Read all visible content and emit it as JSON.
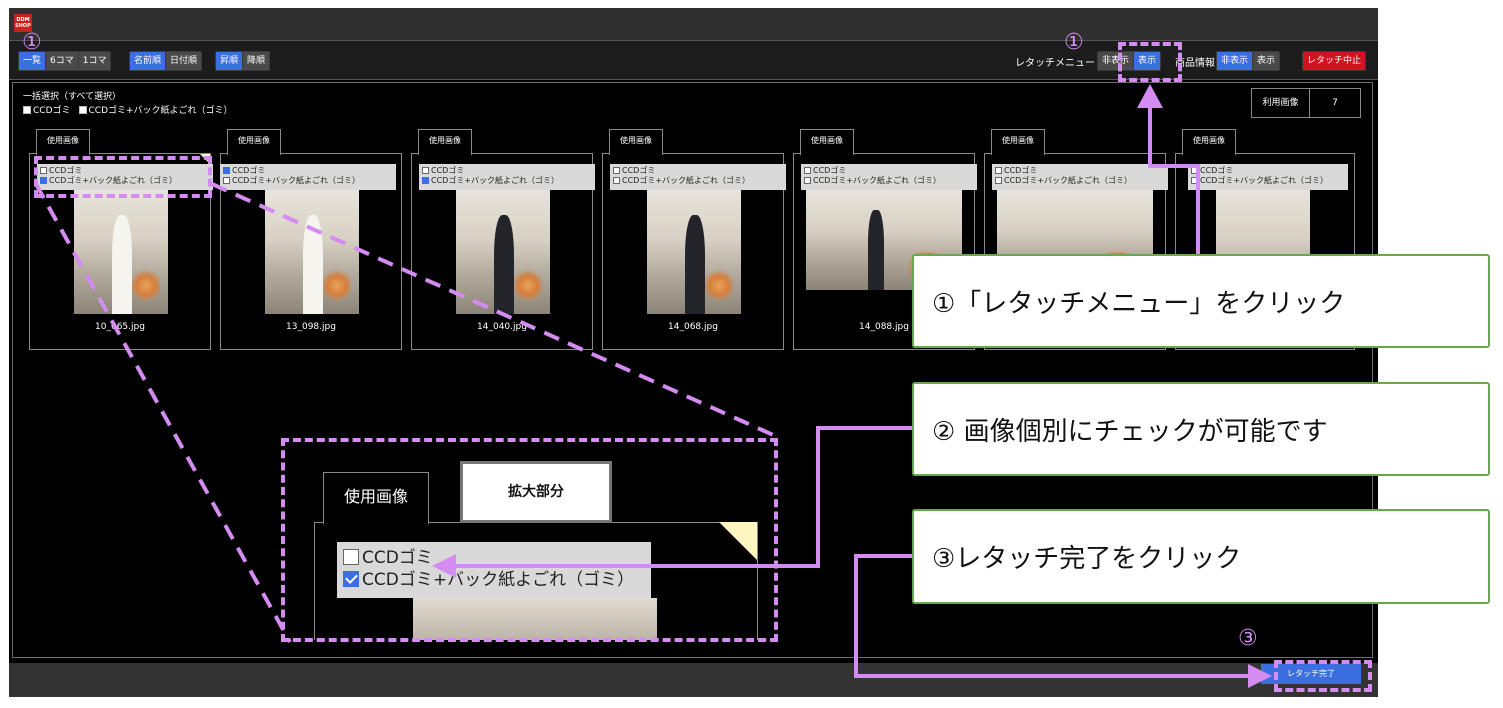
{
  "app": {
    "logo_text": "DDM SHOP"
  },
  "toolbar": {
    "view_group": [
      "一覧",
      "6コマ",
      "1コマ"
    ],
    "sort_group": [
      "名前順",
      "日付順"
    ],
    "order_group": [
      "昇順",
      "降順"
    ],
    "retouch_menu_label": "レタッチメニュー",
    "retouch_menu_options": [
      "非表示",
      "表示"
    ],
    "product_info_label": "商品情報",
    "product_info_options": [
      "非表示",
      "表示"
    ],
    "cancel_button": "レタッチ中止"
  },
  "bulk": {
    "label": "一括選択（すべて選択）",
    "option1": "CCDゴミ",
    "option2": "CCDゴミ+バック紙よごれ（ゴミ）"
  },
  "usage_count": {
    "label": "利用画像",
    "value": "7"
  },
  "cards": [
    {
      "tab": "使用画像",
      "opt1": "CCDゴミ",
      "opt2": "CCDゴミ+バック紙よごれ（ゴミ）",
      "filename": "10_065.jpg"
    },
    {
      "tab": "使用画像",
      "opt1": "CCDゴミ",
      "opt2": "CCDゴミ+バック紙よごれ（ゴミ）",
      "filename": "13_098.jpg"
    },
    {
      "tab": "使用画像",
      "opt1": "CCDゴミ",
      "opt2": "CCDゴミ+バック紙よごれ（ゴミ）",
      "filename": "14_040.jpg"
    },
    {
      "tab": "使用画像",
      "opt1": "CCDゴミ",
      "opt2": "CCDゴミ+バック紙よごれ（ゴミ）",
      "filename": "14_068.jpg"
    },
    {
      "tab": "使用画像",
      "opt1": "CCDゴミ",
      "opt2": "CCDゴミ+バック紙よごれ（ゴミ）",
      "filename": "14_088.jpg"
    },
    {
      "tab": "使用画像",
      "opt1": "CCDゴミ",
      "opt2": "CCDゴミ+バック紙よごれ（ゴミ）",
      "filename": ""
    },
    {
      "tab": "使用画像",
      "opt1": "CCDゴミ",
      "opt2": "CCDゴミ+バック紙よごれ（ゴミ）",
      "filename": ""
    }
  ],
  "zoom": {
    "label": "拡大部分",
    "tab": "使用画像",
    "opt1": "CCDゴミ",
    "opt2": "CCDゴミ+バック紙よごれ（ゴミ）"
  },
  "done_button": "レタッチ完了",
  "callouts": {
    "c1": "①「レタッチメニュー」をクリック",
    "c2": "② 画像個別にチェックが可能です",
    "c3": "③レタッチ完了をクリック"
  },
  "markers": {
    "m1": "①",
    "m2": "①",
    "m3": "③"
  },
  "colors": {
    "accent": "#3b6fe0",
    "danger": "#d2121e",
    "annotation": "#d48cf2",
    "callout_border": "#6aa84f"
  }
}
